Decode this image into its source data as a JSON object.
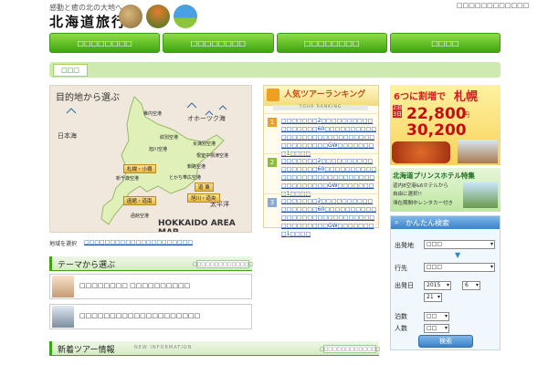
{
  "header": {
    "tagline": "感動と癒の北の大地へ",
    "title": "北海道旅行",
    "toplink": "□□□□□□□□□□□□"
  },
  "gnav": [
    "□□□□□□□□",
    "□□□□□□□□",
    "□□□□□□□□",
    "□□□□"
  ],
  "breadcrumb": "□□□",
  "map": {
    "heading": "目的地から選ぶ",
    "sea_labels": [
      "オホーツク海",
      "日本海",
      "太平洋"
    ],
    "regions": [
      "札幌・小樽",
      "道 東",
      "函館・道南",
      "旭川・道央"
    ],
    "airports": [
      "稚内空港",
      "紋別空港",
      "旭川空港",
      "女満別空港",
      "根室中標津空港",
      "新千歳空港",
      "釧路空港",
      "とかち帯広空港",
      "函館空港"
    ],
    "title": "HOKKAIDO AREA MAP"
  },
  "region_select": {
    "label": "地域を選択",
    "links": "□□□□□□□□□□□□□□□□□□□□□"
  },
  "theme": {
    "title": "テーマから選ぶ",
    "more": "□□□□□□□□□□□□□□",
    "items": [
      "□□□□□□□□ □□□□□□□□□□",
      "□□□□□□□□□□□□□□□□□□□□"
    ]
  },
  "news": {
    "title": "新着ツアー情報",
    "subtitle": "NEW INFORMATION",
    "more": "□□□□□□□□□□□□□□"
  },
  "ranking": {
    "title": "人気ツアーランキング",
    "subtitle": "TOUR RANKING",
    "items": [
      {
        "rank": "1",
        "text": "□□□□□□□2□□□□□□□□□□□□□□□□□60□□□□□□□□□□□□□□□□□□□□□□□□□□□□□□□□□□□□□GW□□□□□□□□1□□□□"
      },
      {
        "rank": "2",
        "text": "□□□□□□□2□□□□□□□□□□□□□□□□□60□□□□□□□□□□□□□□□□□□□□□□□□□□□□□□□□□□□□□GW□□□□□□□□1□□□□"
      },
      {
        "rank": "3",
        "text": "□□□□□□□2□□□□□□□□□□□□□□□□□60□□□□□□□□□□□□□□□□□□□□□□□□□□□□□□□□□□□□□GW□□□□□□□□1□□□□"
      }
    ],
    "colors": [
      "#e8a030",
      "#8cbc3c",
      "#8aa8d0"
    ]
  },
  "banner1": {
    "line1": "6つに割増で",
    "line2": "札幌",
    "side1": "2泊3日",
    "side2": "阪神・中部・西日本",
    "price1": "22,800",
    "price2": "30,200",
    "unit": "円"
  },
  "banner2": {
    "title": "北海道プリンスホテル特集",
    "sub1": "道内8空港&6ホテルから",
    "sub2": "自由に選択!!",
    "sub3": "滞在期間中レンタカー付き"
  },
  "search": {
    "title": "かんたん検索",
    "dep_label": "出発地",
    "dep_value": "□□□",
    "dest_label": "行先",
    "dest_value": "□□□",
    "date_label": "出発日",
    "year": "2015",
    "month": "6",
    "day": "21",
    "nights_label": "泊数",
    "nights": "□□",
    "people_label": "人数",
    "people": "□□",
    "button": "検索"
  }
}
